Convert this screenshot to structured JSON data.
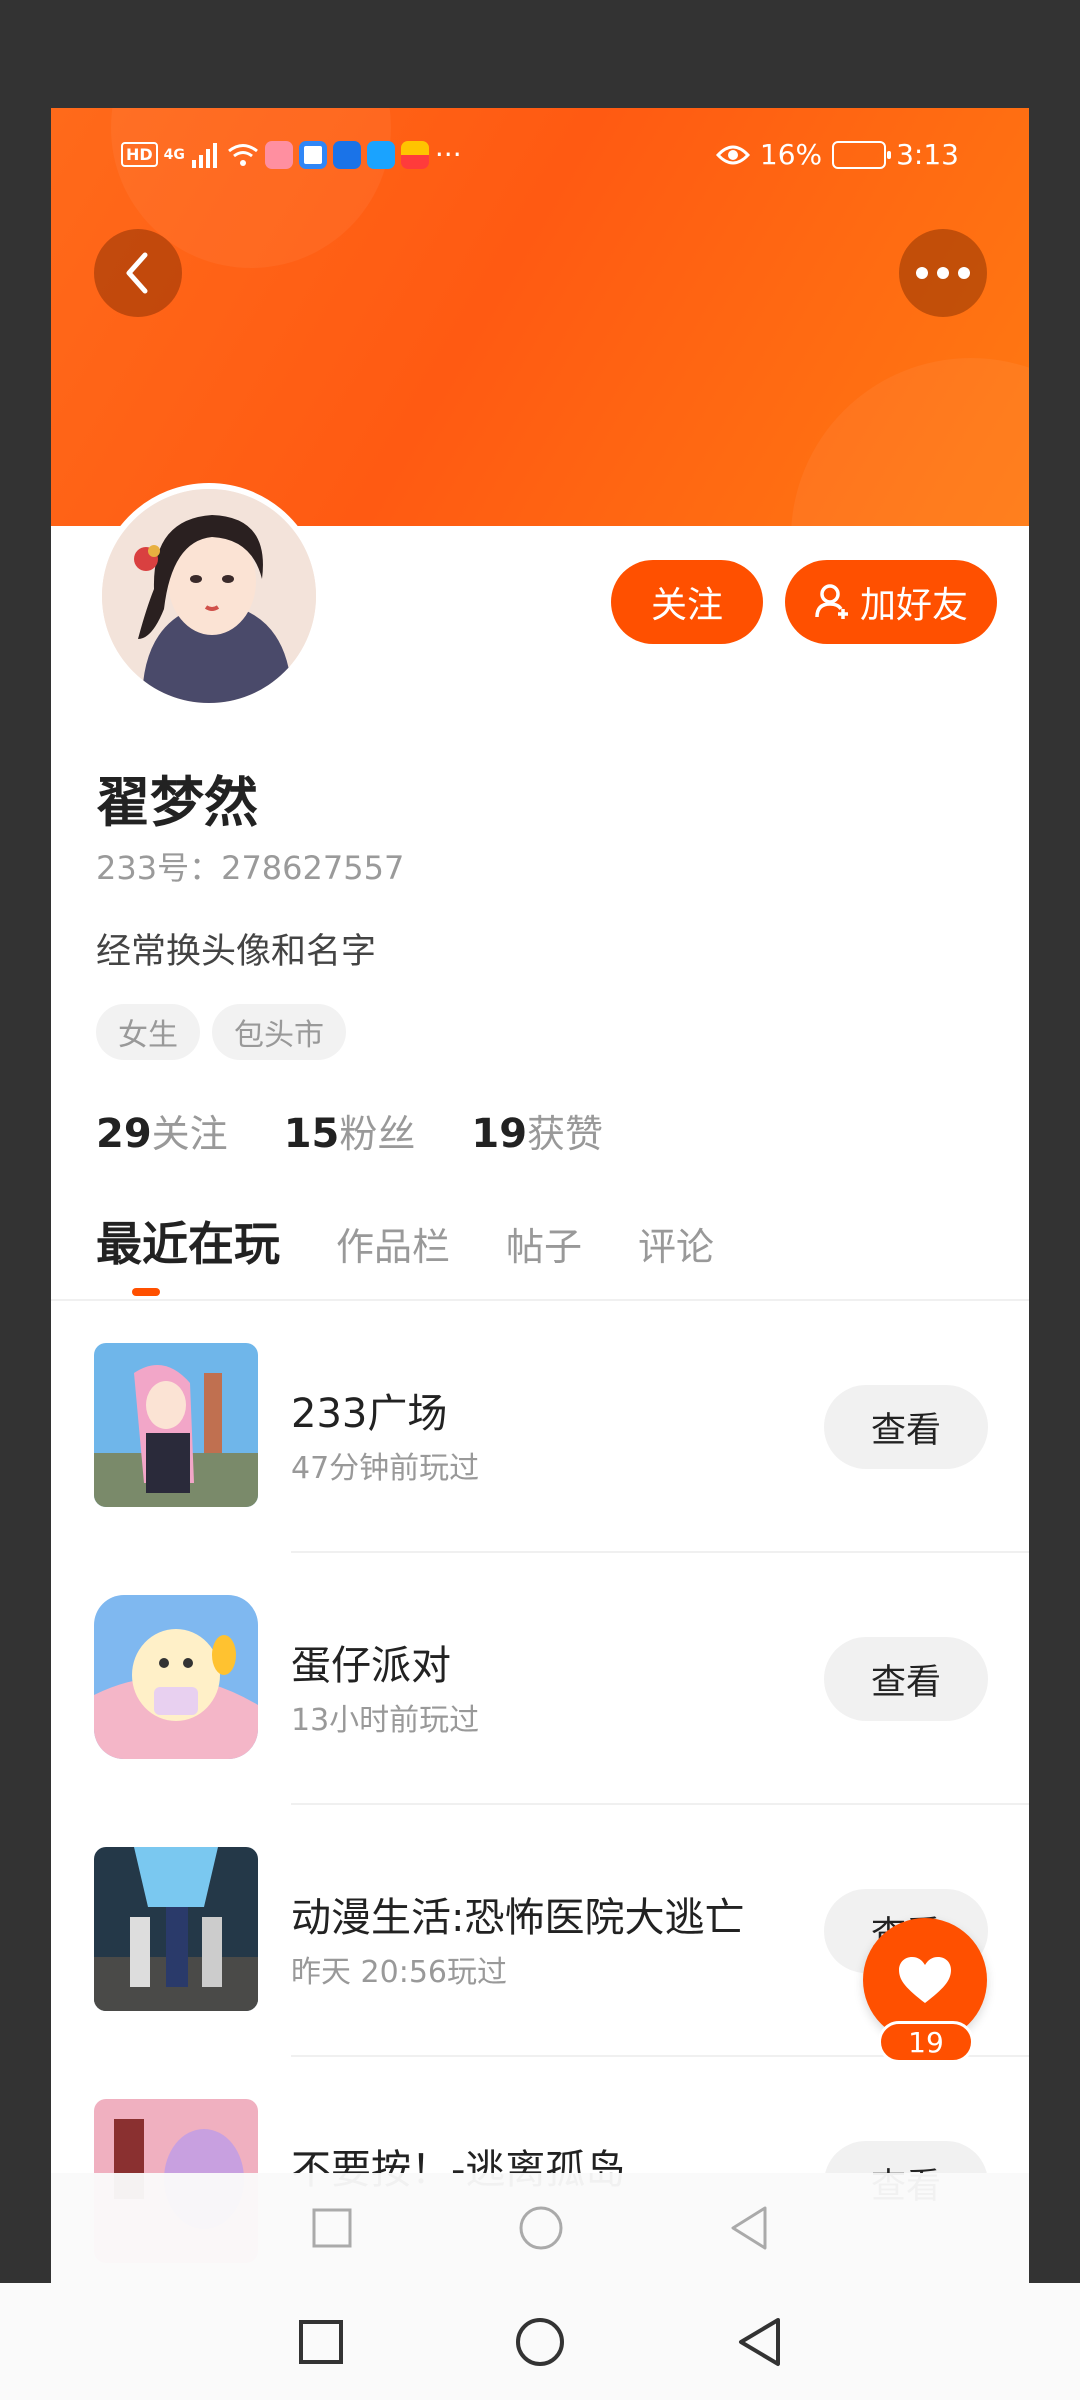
{
  "status_bar": {
    "hd": "HD",
    "network": "4G",
    "more": "···",
    "battery": "16%",
    "time": "3:13"
  },
  "profile": {
    "follow_label": "关注",
    "add_friend_label": "加好友",
    "username": "翟梦然",
    "uid": "233号：278627557",
    "bio": "经常换头像和名字",
    "tags": [
      "女生",
      "包头市"
    ],
    "stats": [
      {
        "num": "29",
        "label": "关注"
      },
      {
        "num": "15",
        "label": "粉丝"
      },
      {
        "num": "19",
        "label": "获赞"
      }
    ]
  },
  "tabs": [
    "最近在玩",
    "作品栏",
    "帖子",
    "评论"
  ],
  "games": [
    {
      "name": "233广场",
      "time": "47分钟前玩过",
      "action": "查看"
    },
    {
      "name": "蛋仔派对",
      "time": "13小时前玩过",
      "action": "查看"
    },
    {
      "name": "动漫生活:恐怖医院大逃亡",
      "time": "昨天 20:56玩过",
      "action": "查看"
    },
    {
      "name": "不要按！-逃离孤岛",
      "time": "",
      "action": "查看"
    }
  ],
  "like_fab": {
    "count": "19"
  },
  "colors": {
    "accent": "#ff5000",
    "hero": "#ff6a1a"
  }
}
